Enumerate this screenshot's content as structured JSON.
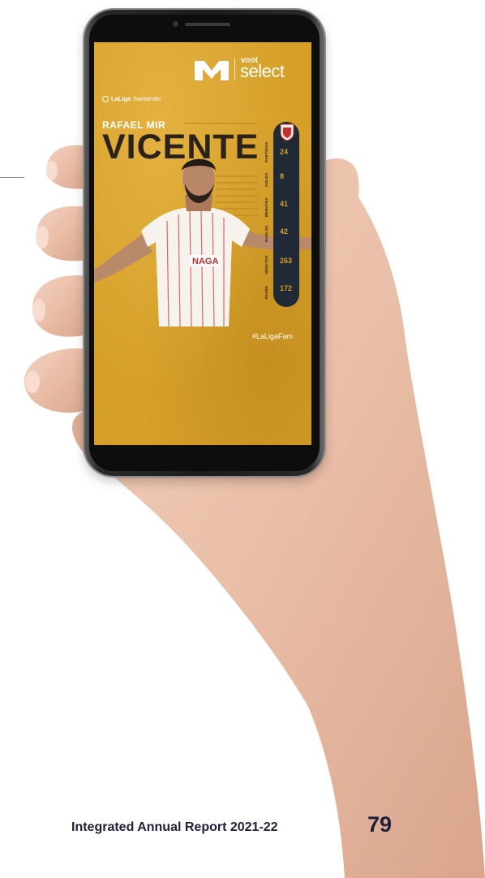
{
  "phone_screen": {
    "brand_mtv": "MTV",
    "brand_voot_top": "voot",
    "brand_voot_bottom": "select",
    "league_label_bold": "LaLiga",
    "league_label_rest": "Santander",
    "player_first_name": "RAFAEL MIR",
    "player_last_name": "VICENTE",
    "shirt_sponsor": "NAGA",
    "stats": [
      {
        "label": "PARTIDOS",
        "value": "24"
      },
      {
        "label": "GOLES",
        "value": "8"
      },
      {
        "label": "REMATES",
        "value": "41"
      },
      {
        "label": "DUELOS",
        "value": "42"
      },
      {
        "label": "MINUTOS",
        "value": "263"
      },
      {
        "label": "PASES",
        "value": "172"
      }
    ],
    "hashtag": "#LaLigaFam"
  },
  "footer": {
    "report_title": "Integrated Annual Report 2021-22",
    "page_number": "79"
  },
  "colors": {
    "screen_background": "#d6a028",
    "stat_bar": "#1f2a36",
    "footer_text": "#1d1f3c"
  }
}
